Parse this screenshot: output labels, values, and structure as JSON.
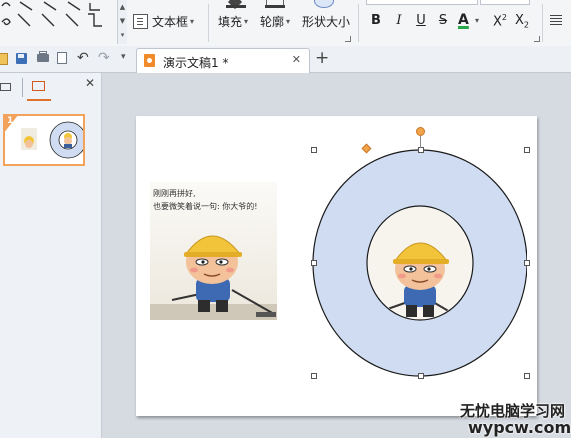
{
  "ribbon": {
    "textbox_label": "文本框",
    "fill_label": "填充",
    "outline_label": "轮廓",
    "shape_size_label": "形状大小",
    "font_bold": "B",
    "font_italic": "I",
    "font_underline": "U",
    "font_strike": "S",
    "font_color": "A",
    "superscript_base": "X",
    "superscript_mark": "2",
    "subscript_base": "X",
    "subscript_mark": "2"
  },
  "document_tab": {
    "title": "演示文稿1 *",
    "close": "✕",
    "new_tab": "+"
  },
  "slides_panel": {
    "close": "✕",
    "slide_number": "1"
  },
  "slide": {
    "caption_line1": "刚刚再拼好,",
    "caption_line2": "也要微笑着说一句: 你大爷的!"
  },
  "watermark": {
    "line1": "无忧电脑学习网",
    "line2": "wypcw.com"
  },
  "colors": {
    "ring_fill": "#cfdcf1",
    "ring_stroke": "#1a1a1a",
    "accent_orange": "#f3a44b",
    "helmet_yellow": "#f2c43a"
  }
}
